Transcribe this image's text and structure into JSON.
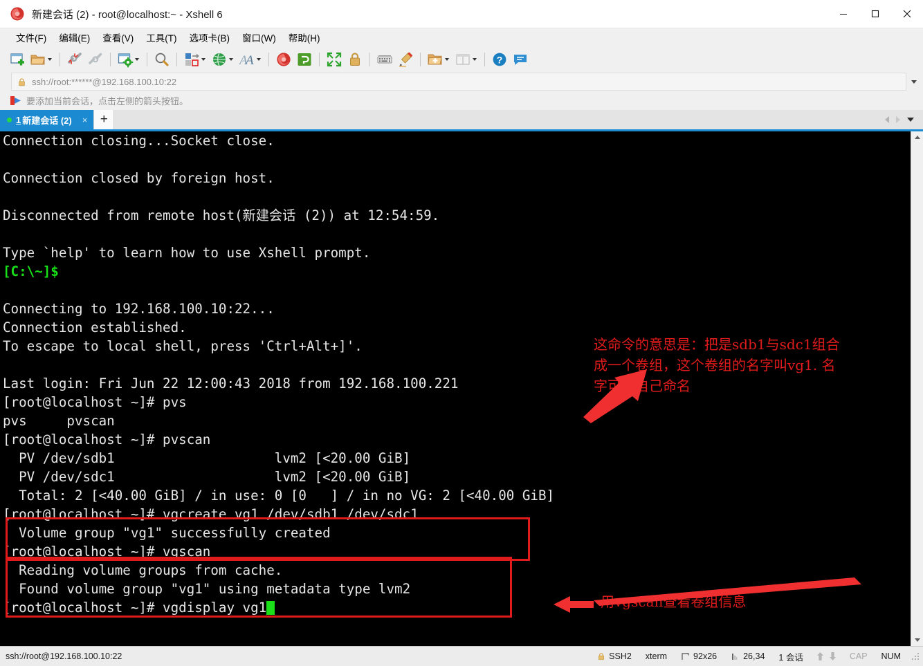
{
  "window": {
    "title": "新建会话 (2) - root@localhost:~ - Xshell 6",
    "app_icon": "xshell-logo-icon",
    "minimize": "–",
    "maximize": "□",
    "close": "✕"
  },
  "menu": {
    "items": [
      {
        "label": "文件(F)",
        "name": "menu-file"
      },
      {
        "label": "编辑(E)",
        "name": "menu-edit"
      },
      {
        "label": "查看(V)",
        "name": "menu-view"
      },
      {
        "label": "工具(T)",
        "name": "menu-tools"
      },
      {
        "label": "选项卡(B)",
        "name": "menu-tabs"
      },
      {
        "label": "窗口(W)",
        "name": "menu-window"
      },
      {
        "label": "帮助(H)",
        "name": "menu-help"
      }
    ]
  },
  "toolbar": {
    "items": [
      "new-session-icon",
      "open-folder-icon",
      "disconnect-icon",
      "reconnect-icon",
      "session-properties-icon",
      "find-icon",
      "transfer-file-icon",
      "globe-icon",
      "font-icon",
      "xshell-icon",
      "xftp-icon",
      "fullscreen-icon",
      "lock-icon",
      "keyboard-icon",
      "highlight-icon",
      "new-folder-icon",
      "layout-icon",
      "help-icon",
      "feedback-icon"
    ]
  },
  "address": {
    "lock_icon": "lock-icon",
    "value": "ssh://root:******@192.168.100.10:22",
    "dropdown_icon": "chevron-down-icon"
  },
  "bookmark_bar": {
    "icon": "add-bookmark-arrow-icon",
    "text": "要添加当前会话，点击左侧的箭头按钮。"
  },
  "tabs": {
    "active": {
      "status_dot": "connected-dot-icon",
      "number": "1",
      "label": "新建会话 (2)",
      "close": "×"
    },
    "new_tab": "+",
    "nav_left": "prev-tab-icon",
    "nav_right": "next-tab-icon",
    "nav_list": "tab-list-icon"
  },
  "terminal": {
    "lines": [
      {
        "text": "Connection closing...Socket close."
      },
      {
        "text": ""
      },
      {
        "text": "Connection closed by foreign host."
      },
      {
        "text": ""
      },
      {
        "text": "Disconnected from remote host(新建会话 (2)) at 12:54:59."
      },
      {
        "text": ""
      },
      {
        "text": "Type `help' to learn how to use Xshell prompt."
      },
      {
        "text": "[C:\\~]$",
        "color": "green"
      },
      {
        "text": ""
      },
      {
        "text": "Connecting to 192.168.100.10:22..."
      },
      {
        "text": "Connection established."
      },
      {
        "text": "To escape to local shell, press 'Ctrl+Alt+]'."
      },
      {
        "text": ""
      },
      {
        "text": "Last login: Fri Jun 22 12:00:43 2018 from 192.168.100.221"
      },
      {
        "text": "[root@localhost ~]# pvs"
      },
      {
        "text": "pvs     pvscan"
      },
      {
        "text": "[root@localhost ~]# pvscan"
      },
      {
        "text": "  PV /dev/sdb1                    lvm2 [<20.00 GiB]"
      },
      {
        "text": "  PV /dev/sdc1                    lvm2 [<20.00 GiB]"
      },
      {
        "text": "  Total: 2 [<40.00 GiB] / in use: 0 [0   ] / in no VG: 2 [<40.00 GiB]"
      },
      {
        "text": "[root@localhost ~]# vgcreate vg1 /dev/sdb1 /dev/sdc1"
      },
      {
        "text": "  Volume group \"vg1\" successfully created"
      },
      {
        "text": "[root@localhost ~]# vgscan"
      },
      {
        "text": "  Reading volume groups from cache."
      },
      {
        "text": "  Found volume group \"vg1\" using metadata type lvm2"
      },
      {
        "text": "[root@localhost ~]# vgdisplay vg1",
        "cursor": true
      }
    ],
    "scrollbar": {
      "up": "scroll-up-icon",
      "down": "scroll-down-icon"
    }
  },
  "annotations": {
    "color": "#e01b1b",
    "note1": "这命令的意思是：把是sdb1与sdc1组合\n成一个卷组，这个卷组的名字叫vg1. 名\n字可以自己命名",
    "note2": "用vgscan查看卷组信息"
  },
  "status_bar": {
    "connection": "ssh://root@192.168.100.10:22",
    "protocol": "SSH2",
    "terminal_type": "xterm",
    "size": "92x26",
    "cursor_pos": "26,34",
    "sessions": "1 会话",
    "cap": "CAP",
    "num": "NUM"
  }
}
